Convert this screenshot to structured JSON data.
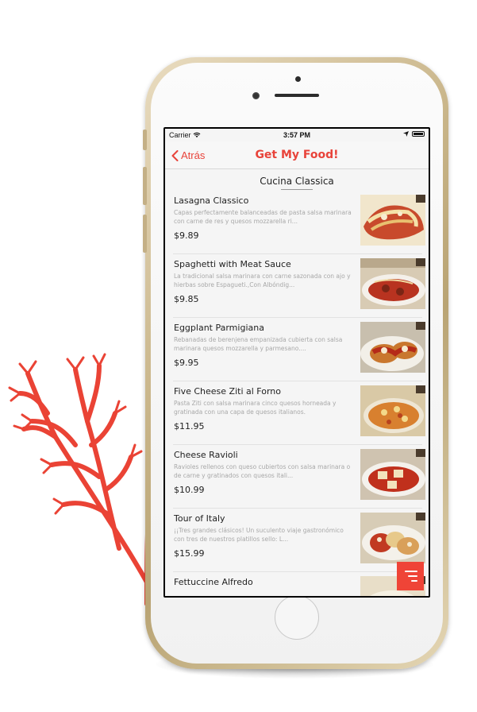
{
  "status_bar": {
    "carrier": "Carrier",
    "time": "3:57 PM"
  },
  "nav": {
    "back_label": "Atrás",
    "title": "Get My Food!"
  },
  "section": {
    "title": "Cucina Classica"
  },
  "colors": {
    "accent": "#e8433a",
    "fab": "#ef4437",
    "coral": "#ea4335"
  },
  "menu_items": [
    {
      "name": "Lasagna Classico",
      "description": "Capas perfectamente balanceadas de pasta salsa marinara con carne de res y quesos mozzarella ri...",
      "price": "$9.89"
    },
    {
      "name": "Spaghetti with Meat Sauce",
      "description": "La tradicional salsa marinara con carne sazonada con ajo y hierbas sobre Espagueti.,Con Albóndig...",
      "price": "$9.85"
    },
    {
      "name": "Eggplant Parmigiana",
      "description": "Rebanadas de berenjena empanizada cubierta con salsa marinara quesos mozzarella y parmesano....",
      "price": "$9.95"
    },
    {
      "name": "Five Cheese Ziti al Forno",
      "description": "Pasta Ziti con salsa marinara cinco quesos horneada y gratinada con una capa de quesos italianos.",
      "price": "$11.95"
    },
    {
      "name": "Cheese Ravioli",
      "description": "Ravioles rellenos con queso cubiertos con salsa marinara o de carne y gratinados con quesos itali...",
      "price": "$10.99"
    },
    {
      "name": "Tour of Italy",
      "description": "¡¡Tres grandes clásicos! Un suculento viaje gastronómico con tres de nuestros platillos sello: L...",
      "price": "$15.99"
    },
    {
      "name": "Fettuccine Alfredo",
      "description": "",
      "price": ""
    }
  ],
  "icons": {
    "back": "chevron-left-icon",
    "menu": "menu-lines-icon",
    "wifi": "wifi-icon",
    "location": "location-arrow-icon",
    "battery": "battery-icon"
  }
}
